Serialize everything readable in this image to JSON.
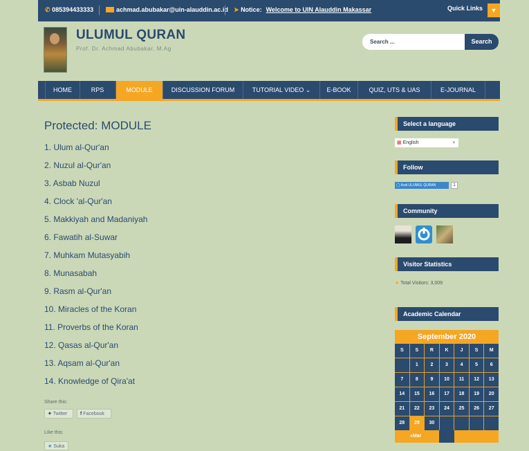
{
  "topbar": {
    "phone": "085394433333",
    "email": "achmad.abubakar@uin-alauddin.ac.id",
    "notice_label": "Notice:",
    "notice_text": "Welcome to UIN Alauddin Makassar",
    "quick_links": "Quick Links"
  },
  "header": {
    "title": "ULUMUL QURAN",
    "subtitle": "Prof. Dr. Achmad Abubakar, M.Ag",
    "search_placeholder": "Search ...",
    "search_button": "Search"
  },
  "nav": [
    {
      "label": "HOME"
    },
    {
      "label": "RPS"
    },
    {
      "label": "MODULE"
    },
    {
      "label": "DISCUSSION FORUM"
    },
    {
      "label": "TUTORIAL VIDEO ⌄"
    },
    {
      "label": "E-BOOK"
    },
    {
      "label": "QUIZ, UTS & UAS"
    },
    {
      "label": "E-JOURNAL"
    }
  ],
  "page": {
    "title": "Protected: MODULE",
    "modules": [
      "1. Ulum al-Qur'an",
      "2. Nuzul al-Qur'an",
      "3. Asbab Nuzul",
      "4. Clock 'al-Qur'an",
      "5. Makkiyah and Madaniyah",
      "6.  Fawatih al-Suwar",
      "7.  Muhkam Mutasyabih",
      "8.  Munasabah",
      "9.  Rasm al-Qur'an",
      "10. Miracles of the Koran",
      "11. Proverbs of the Koran",
      "12. Qasas al-Qur'an",
      "13. Aqsam al-Qur'an",
      "14. Knowledge of Qira'at"
    ],
    "share_label": "Share this:",
    "twitter": "Twitter",
    "facebook": "Facebook",
    "like_label": "Like this:",
    "like_button": "Suka"
  },
  "sidebar": {
    "language_title": "Select a language",
    "language_value": "English",
    "follow_title": "Follow",
    "follow_button": "Ikuti ULUMUL QURAN",
    "follow_count": "1",
    "community_title": "Community",
    "visitor_title": "Visitor Statistics",
    "visitor_text": "Total Visitors: 3,009",
    "calendar_title": "Academic Calendar",
    "calendar": {
      "month": "September 2020",
      "weekdays": [
        "S",
        "S",
        "R",
        "K",
        "J",
        "S",
        "M"
      ],
      "today": "29",
      "prev": "«Mar"
    }
  },
  "colors": {
    "background": "#cbd8b8",
    "navy": "#2a4a6e",
    "accent": "#f5a623"
  }
}
